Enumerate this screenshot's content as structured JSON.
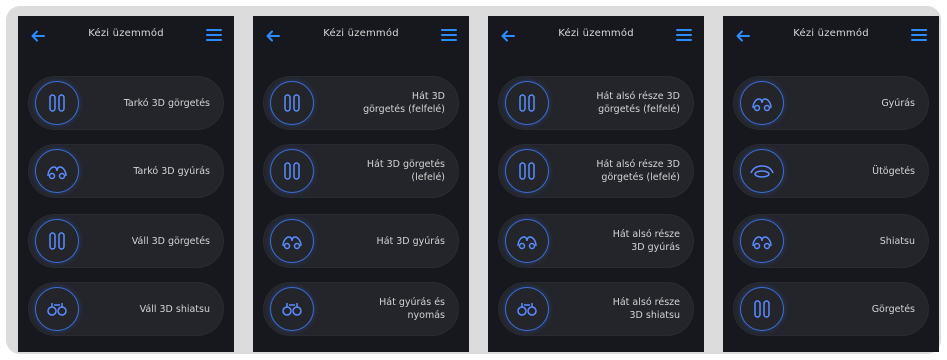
{
  "screens": [
    {
      "title": "Kézi üzemmód",
      "items": [
        {
          "label": "Tarkó 3D görgetés",
          "icon": "roller-icon"
        },
        {
          "label": "Tarkó 3D gyúrás",
          "icon": "kneading-icon"
        },
        {
          "label": "Váll 3D görgetés",
          "icon": "roller-icon"
        },
        {
          "label": "Váll 3D shiatsu",
          "icon": "shiatsu-icon"
        }
      ]
    },
    {
      "title": "Kézi üzemmód",
      "items": [
        {
          "label": "Hát 3D\ngörgetés (felfelé)",
          "icon": "roller-icon"
        },
        {
          "label": "Hát 3D görgetés\n(lefelé)",
          "icon": "roller-icon"
        },
        {
          "label": "Hát 3D gyúrás",
          "icon": "kneading-icon"
        },
        {
          "label": "Hát gyúrás és\nnyomás",
          "icon": "shiatsu-icon"
        }
      ]
    },
    {
      "title": "Kézi üzemmód",
      "items": [
        {
          "label": "Hát alsó része 3D\ngörgetés (felfelé)",
          "icon": "roller-icon"
        },
        {
          "label": "Hát alsó része 3D\ngörgetés (lefelé)",
          "icon": "roller-icon"
        },
        {
          "label": "Hát alsó része\n3D gyúrás",
          "icon": "kneading-icon"
        },
        {
          "label": "Hát alsó része\n3D shiatsu",
          "icon": "shiatsu-icon"
        }
      ]
    },
    {
      "title": "Kézi üzemmód",
      "items": [
        {
          "label": "Gyúrás",
          "icon": "kneading-icon"
        },
        {
          "label": "Ütögetés",
          "icon": "tapping-icon"
        },
        {
          "label": "Shiatsu",
          "icon": "kneading-icon"
        },
        {
          "label": "Görgetés",
          "icon": "roller-icon"
        }
      ]
    }
  ],
  "colors": {
    "accent": "#2a8cff",
    "screen_bg": "#17181d",
    "card_bg": "#24252b",
    "ring": "#3b6fd8"
  }
}
